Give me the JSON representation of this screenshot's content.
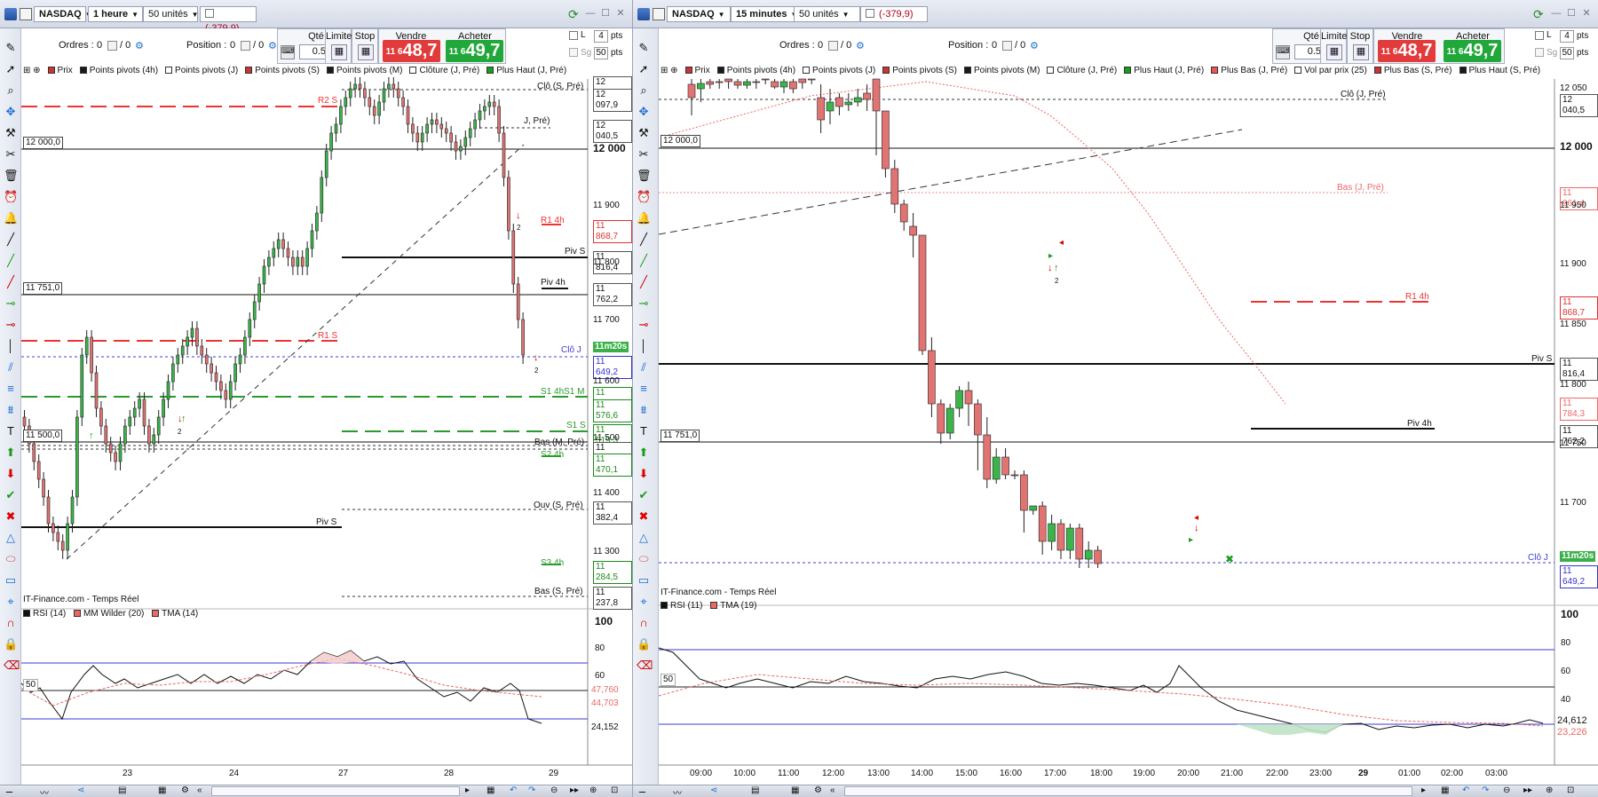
{
  "left": {
    "symbol": "NASDAQ",
    "timeframe": "1 heure",
    "units": "50 unités",
    "pnl": "(-379,9)",
    "orders_label": "Ordres :",
    "orders_count": "0",
    "orders_sep": "/ 0",
    "position_label": "Position :",
    "position_count": "0",
    "position_sep": "/ 0",
    "qty_label": "Qté",
    "qty_value": "0.5",
    "limit_label": "Limite",
    "stop_label": "Stop",
    "sell_label": "Vendre",
    "sell_price_small": "11 6",
    "sell_price_big": "48,7",
    "buy_label": "Acheter",
    "buy_price_small": "11 6",
    "buy_price_big": "49,7",
    "l_label": "L",
    "sg_label": "Sg",
    "pts_top": "4",
    "pts_top_unit": "pts",
    "pts_bottom": "50",
    "pts_bottom_unit": "pts",
    "indicators": [
      "Prix",
      "Points pivots (4h)",
      "Points pivots (J)",
      "Points pivots (S)",
      "Points pivots (M)",
      "Clôture (J, Pré)",
      "Plus Haut (J, Pré)"
    ],
    "source": "IT-Finance.com - Temps Réel",
    "rsi_legend": [
      "RSI (14)",
      "MM Wilder (20)",
      "TMA (14)"
    ],
    "price_axis": [
      "12 113,5",
      "12 097,9",
      "12 040,5",
      "12 000",
      "11 900",
      "11 868,7",
      "11 816,4",
      "11 800",
      "11 762,2",
      "11 700",
      "11m20s",
      "11 649,2",
      "11 600",
      "11 577,2",
      "11 576,6",
      "11 519,3",
      "11 500",
      "11 489,9",
      "11 470,1",
      "11 400",
      "11 382,4",
      "11 300",
      "11 284,5",
      "11 237,8"
    ],
    "rsi_axis": [
      "100",
      "80",
      "60",
      "47,760",
      "44,703",
      "24,152"
    ],
    "rsi_level": "50",
    "hlines": [
      "12 000,0",
      "11 751,0",
      "11 500,0"
    ],
    "line_labels": [
      "Clô (S, Pré)",
      "R2 S",
      "J, Pré)",
      "R1 4h",
      "Piv S",
      "Piv 4h",
      "R1 S",
      "Clô J",
      "S1 4hS1 M",
      "S1 S",
      "Bas (M, Pré)",
      "S2 4h",
      "Ouv (S, Pré)",
      "Piv S",
      "S3 4h",
      "Bas (S, Pré)"
    ],
    "signal_counts": [
      "2",
      "2",
      "2"
    ],
    "time_axis": [
      "23",
      "24",
      "27",
      "28",
      "29"
    ]
  },
  "right": {
    "symbol": "NASDAQ",
    "timeframe": "15 minutes",
    "units": "50 unités",
    "pnl": "(-379,9)",
    "orders_label": "Ordres :",
    "orders_count": "0",
    "orders_sep": "/ 0",
    "position_label": "Position :",
    "position_count": "0",
    "position_sep": "/ 0",
    "qty_label": "Qté",
    "qty_value": "0.5",
    "limit_label": "Limite",
    "stop_label": "Stop",
    "sell_label": "Vendre",
    "sell_price_small": "11 6",
    "sell_price_big": "48,7",
    "buy_label": "Acheter",
    "buy_price_small": "11 6",
    "buy_price_big": "49,7",
    "l_label": "L",
    "sg_label": "Sg",
    "pts_top": "4",
    "pts_top_unit": "pts",
    "pts_bottom": "50",
    "pts_bottom_unit": "pts",
    "indicators": [
      "Prix",
      "Points pivots (4h)",
      "Points pivots (J)",
      "Points pivots (S)",
      "Points pivots (M)",
      "Clôture (J, Pré)",
      "Plus Haut (J, Pré)",
      "Plus Bas (J, Pré)",
      "Vol par prix (25)",
      "Plus Bas (S, Pré)",
      "Plus Haut (S, Pré)"
    ],
    "source": "IT-Finance.com - Temps Réel",
    "rsi_legend": [
      "RSI (11)",
      "TMA (19)"
    ],
    "price_axis": [
      "12 050",
      "12 040,5",
      "12 000",
      "11 961,4",
      "11 950",
      "11 900",
      "11 868,7",
      "11 850",
      "11 816,4",
      "11 800",
      "11 784,3",
      "11 762,2",
      "11 750",
      "11 700",
      "11m20s",
      "11 649,2"
    ],
    "rsi_axis": [
      "100",
      "80",
      "60",
      "40",
      "24,612",
      "23,226"
    ],
    "rsi_level": "50",
    "hlines": [
      "12 000,0",
      "11 751,0"
    ],
    "line_labels": [
      "Clô (J, Pré)",
      "Bas (J, Pré)",
      "R1 4h",
      "Piv S",
      "Piv 4h",
      "Clô J"
    ],
    "signal_counts": [
      "2"
    ],
    "time_axis": [
      "09:00",
      "10:00",
      "11:00",
      "12:00",
      "13:00",
      "14:00",
      "15:00",
      "16:00",
      "17:00",
      "18:00",
      "19:00",
      "20:00",
      "21:00",
      "22:00",
      "23:00",
      "29",
      "01:00",
      "02:00",
      "03:00"
    ]
  }
}
